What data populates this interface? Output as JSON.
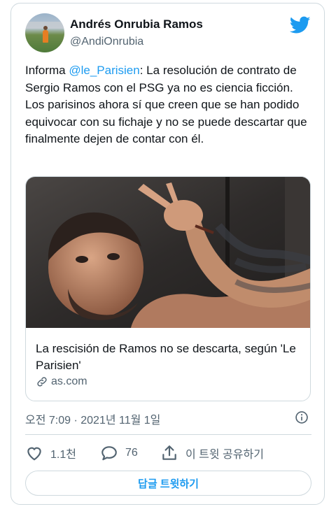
{
  "author": {
    "name": "Andrés Onrubia Ramos",
    "handle": "@AndiOnrubia"
  },
  "tweet": {
    "text_before": "Informa ",
    "mention": "@le_Parisien",
    "text_after": ": La resolución de contrato de Sergio Ramos con el PSG ya no es ciencia ficción. Los parisinos ahora sí que creen que se han podido equivocar con su fichaje y no se puede descartar que finalmente dejen de contar con él."
  },
  "link_card": {
    "title": "La rescisión de Ramos no se descarta, según 'Le Parisien'",
    "domain": "as.com"
  },
  "timestamp": "오전 7:09 · 2021년 11월 1일",
  "actions": {
    "likes": "1.1천",
    "replies": "76",
    "share": "이 트윗 공유하기"
  },
  "reply_button": "답글 트윗하기",
  "colors": {
    "brand": "#1d9bf0",
    "heart": "#536471",
    "text": "#0f1419",
    "muted": "#536471",
    "border": "#cfd9de"
  }
}
